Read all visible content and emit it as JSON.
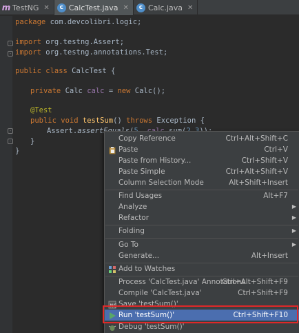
{
  "tabs": [
    {
      "label": "TestNG",
      "icon": "testng-icon",
      "active": false
    },
    {
      "label": "CalcTest.java",
      "icon": "class-icon",
      "active": true
    },
    {
      "label": "Calc.java",
      "icon": "class-icon",
      "active": false
    }
  ],
  "code": {
    "package_kw": "package",
    "package_name": " com.devcolibri.logic;",
    "import_kw": "import",
    "import1": " org.testng.Assert;",
    "import2": " org.testng.annotations.Test;",
    "class_kw": "public class",
    "class_name": " CalcTest {",
    "field_kw": "private",
    "field_type": " Calc ",
    "field_name": "calc",
    "field_eq": " = ",
    "new_kw": "new",
    "field_init": " Calc();",
    "annotation": "@Test",
    "method_kw": "public void",
    "method_name": "testSum",
    "method_parens": "()",
    "throws_kw": "throws",
    "exception": " Exception {",
    "assert_cls": "Assert.",
    "assert_fn": "assertEquals",
    "assert_open": "(",
    "assert_num1": "5",
    "assert_sep": ", ",
    "assert_field": "calc",
    "assert_call": ".sum(",
    "assert_num2": "2",
    "assert_comma": ",",
    "assert_num3": "3",
    "assert_close": "));",
    "close_brace": "}",
    "close_brace2": "}"
  },
  "menu": {
    "copy_reference": {
      "label": "Copy Reference",
      "shortcut": "Ctrl+Alt+Shift+C"
    },
    "paste": {
      "label": "Paste",
      "shortcut": "Ctrl+V"
    },
    "paste_history": {
      "label": "Paste from History...",
      "shortcut": "Ctrl+Shift+V"
    },
    "paste_simple": {
      "label": "Paste Simple",
      "shortcut": "Ctrl+Alt+Shift+V"
    },
    "column_selection": {
      "label": "Column Selection Mode",
      "shortcut": "Alt+Shift+Insert"
    },
    "find_usages": {
      "label": "Find Usages",
      "shortcut": "Alt+F7"
    },
    "analyze": {
      "label": "Analyze"
    },
    "refactor": {
      "label": "Refactor"
    },
    "folding": {
      "label": "Folding"
    },
    "go_to": {
      "label": "Go To"
    },
    "generate": {
      "label": "Generate...",
      "shortcut": "Alt+Insert"
    },
    "add_watches": {
      "label": "Add to Watches"
    },
    "process_annotations": {
      "label": "Process 'CalcTest.java' Annotations",
      "shortcut": "Ctrl+Alt+Shift+F9"
    },
    "compile": {
      "label": "Compile 'CalcTest.java'",
      "shortcut": "Ctrl+Shift+F9"
    },
    "save": {
      "label": "Save 'testSum()'"
    },
    "run": {
      "label": "Run 'testSum()'",
      "shortcut": "Ctrl+Shift+F10"
    },
    "debug": {
      "label": "Debug 'testSum()'"
    }
  },
  "colors": {
    "editor_bg": "#2b2b2b",
    "menu_bg": "#3c3f41",
    "selection": "#4b6eaf",
    "highlight_box": "#e02828",
    "run_icon": "#59a869"
  }
}
